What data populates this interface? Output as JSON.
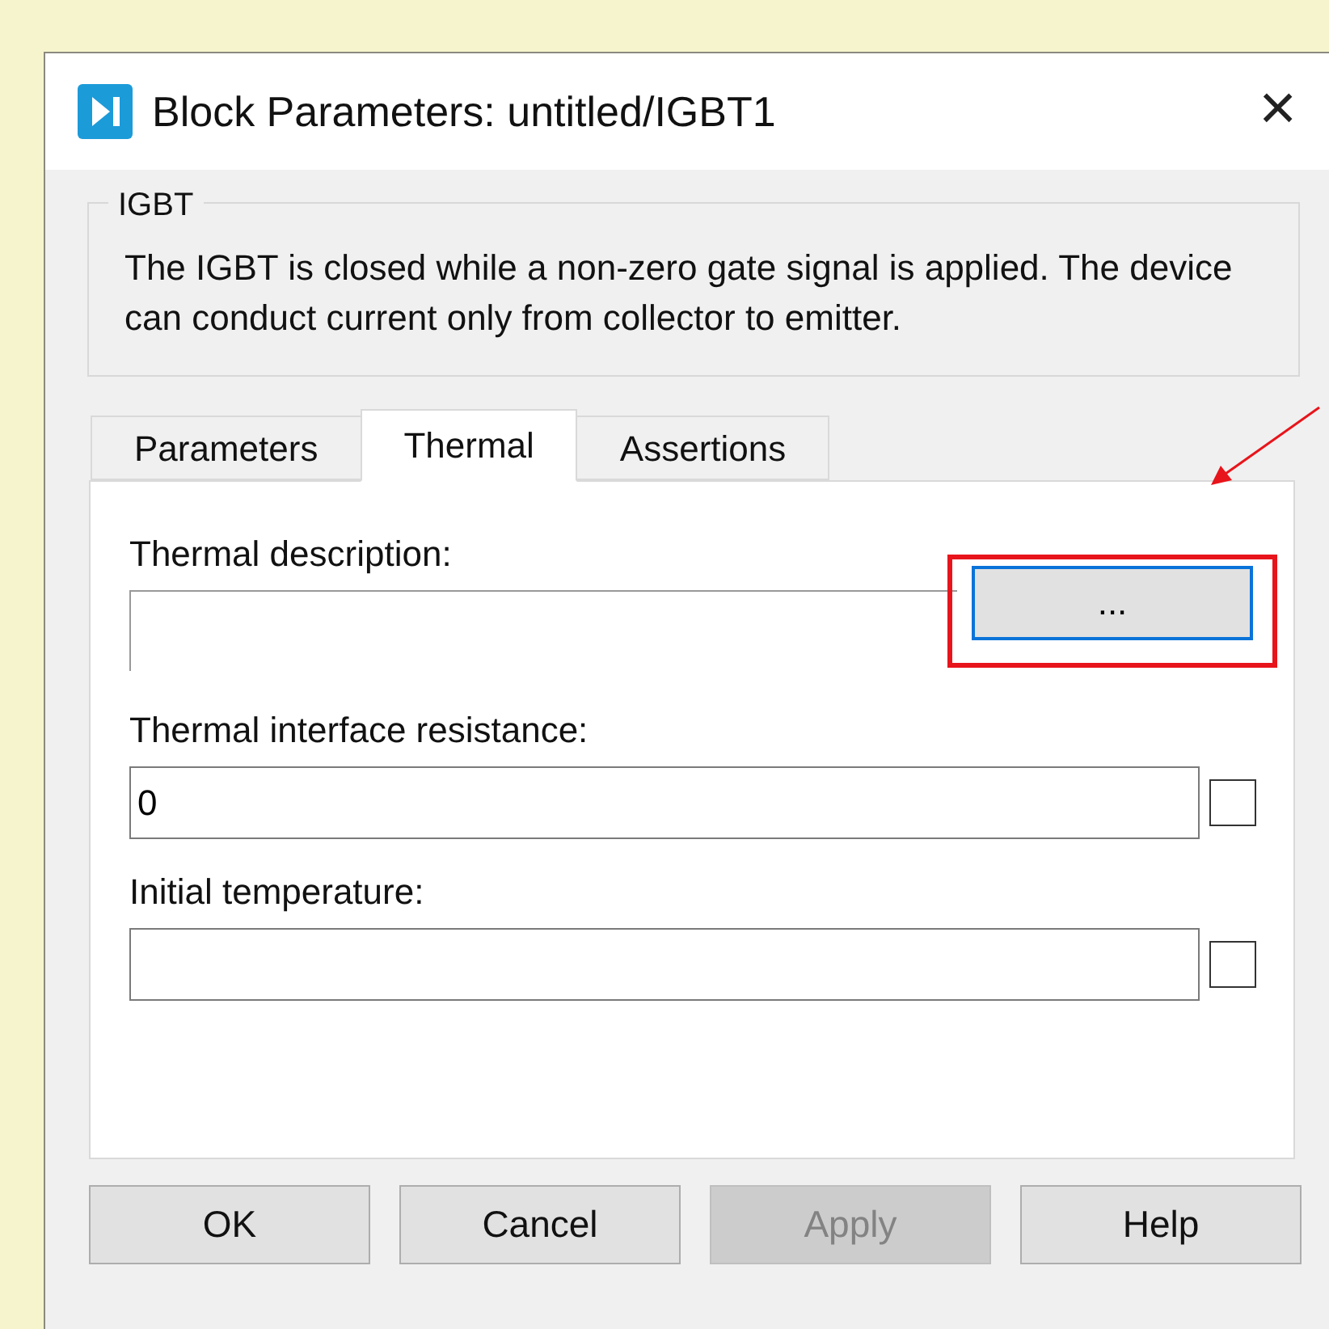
{
  "window": {
    "title": "Block Parameters: untitled/IGBT1",
    "close": "×"
  },
  "group": {
    "title": "IGBT",
    "description": "The IGBT is closed while a non-zero gate signal is applied. The device can conduct current only from collector to emitter."
  },
  "tabs": [
    {
      "label": "Parameters",
      "selected": false
    },
    {
      "label": "Thermal",
      "selected": true
    },
    {
      "label": "Assertions",
      "selected": false
    }
  ],
  "fields": [
    {
      "kind": "browse",
      "label": "Thermal description:",
      "button": "...",
      "highlighted": true
    },
    {
      "kind": "text",
      "label": "Thermal interface resistance:",
      "value": "0",
      "checked": false
    },
    {
      "kind": "text",
      "label": "Initial temperature:",
      "checked": false
    }
  ],
  "buttons": [
    {
      "label": "OK",
      "disabled": false
    },
    {
      "label": "Cancel",
      "disabled": false
    },
    {
      "label": "Apply",
      "disabled": true
    },
    {
      "label": "Help",
      "disabled": false
    }
  ]
}
